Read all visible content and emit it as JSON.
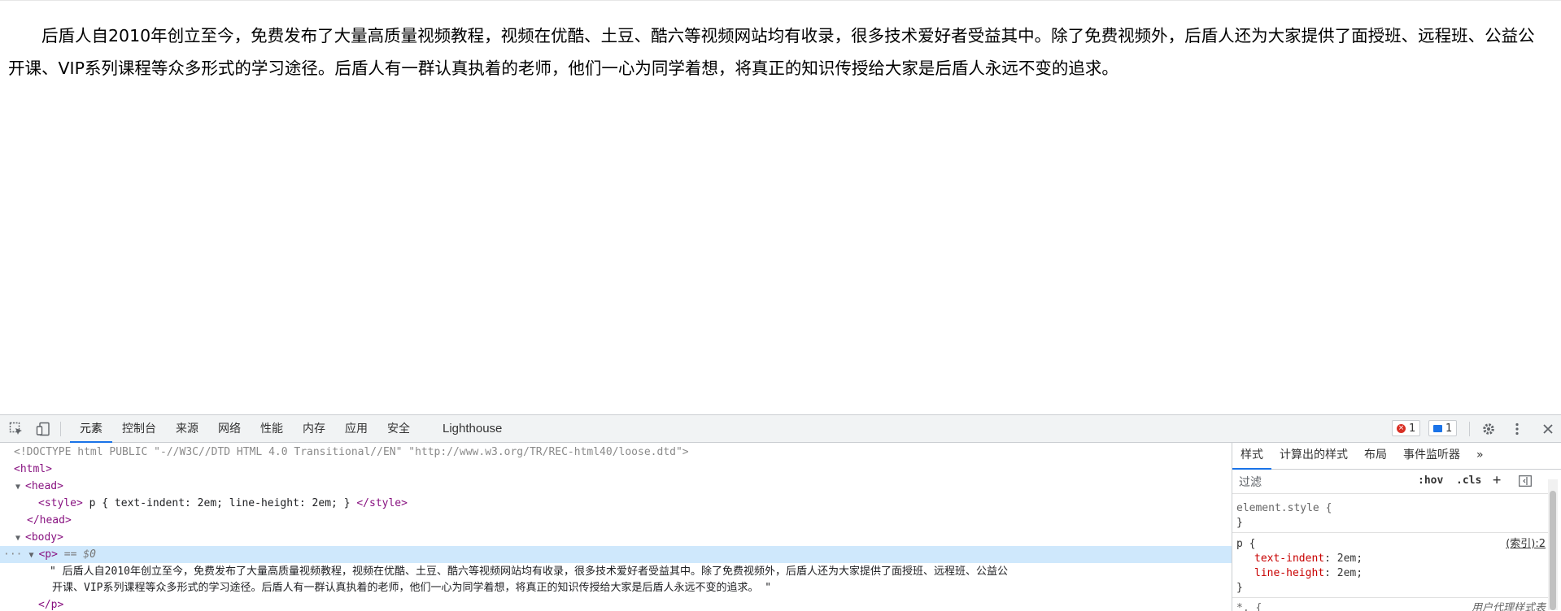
{
  "page": {
    "paragraph": "后盾人自2010年创立至今，免费发布了大量高质量视频教程，视频在优酷、土豆、酷六等视频网站均有收录，很多技术爱好者受益其中。除了免费视频外，后盾人还为大家提供了面授班、远程班、公益公开课、VIP系列课程等众多形式的学习途径。后盾人有一群认真执着的老师，他们一心为同学着想，将真正的知识传授给大家是后盾人永远不变的追求。"
  },
  "devtools": {
    "tabs": [
      "元素",
      "控制台",
      "来源",
      "网络",
      "性能",
      "内存",
      "应用",
      "安全",
      "Lighthouse"
    ],
    "active_tab": "元素",
    "error_count": "1",
    "message_count": "1",
    "elements": {
      "doctype": "<!DOCTYPE html PUBLIC \"-//W3C//DTD HTML 4.0 Transitional//EN\" \"http://www.w3.org/TR/REC-html40/loose.dtd\">",
      "html_open": "<html>",
      "head_open": "<head>",
      "style_open": "<style>",
      "style_body": " p { text-indent: 2em; line-height: 2em; } ",
      "style_close": "</style>",
      "head_close": "</head>",
      "body_open": "<body>",
      "p_open": "<p>",
      "selected_marker": "== $0",
      "dots": "···",
      "text_line_1": "\" 后盾人自2010年创立至今，免费发布了大量高质量视频教程，视频在优酷、土豆、酷六等视频网站均有收录，很多技术爱好者受益其中。除了免费视频外，后盾人还为大家提供了面授班、远程班、公益公",
      "text_line_2": "开课、VIP系列课程等众多形式的学习途径。后盾人有一群认真执着的老师，他们一心为同学着想，将真正的知识传授给大家是后盾人永远不变的追求。 \"",
      "p_close": "</p>"
    },
    "styles": {
      "tabs": [
        "样式",
        "计算出的样式",
        "布局",
        "事件监听器",
        "»"
      ],
      "active_tab": "样式",
      "filter_placeholder": "过滤",
      "hov": ":hov",
      "cls": ".cls",
      "plus": "+",
      "element_style_selector": "element.style {",
      "close_brace": "}",
      "p_selector": "p {",
      "p_source": "(索引):2",
      "decl_1_prop": "text-indent",
      "decl_1_val": "2em;",
      "decl_2_prop": "line-height",
      "decl_2_val": "2em;",
      "partial_next": "*, {",
      "partial_next_source": "用户代理样式表"
    }
  }
}
